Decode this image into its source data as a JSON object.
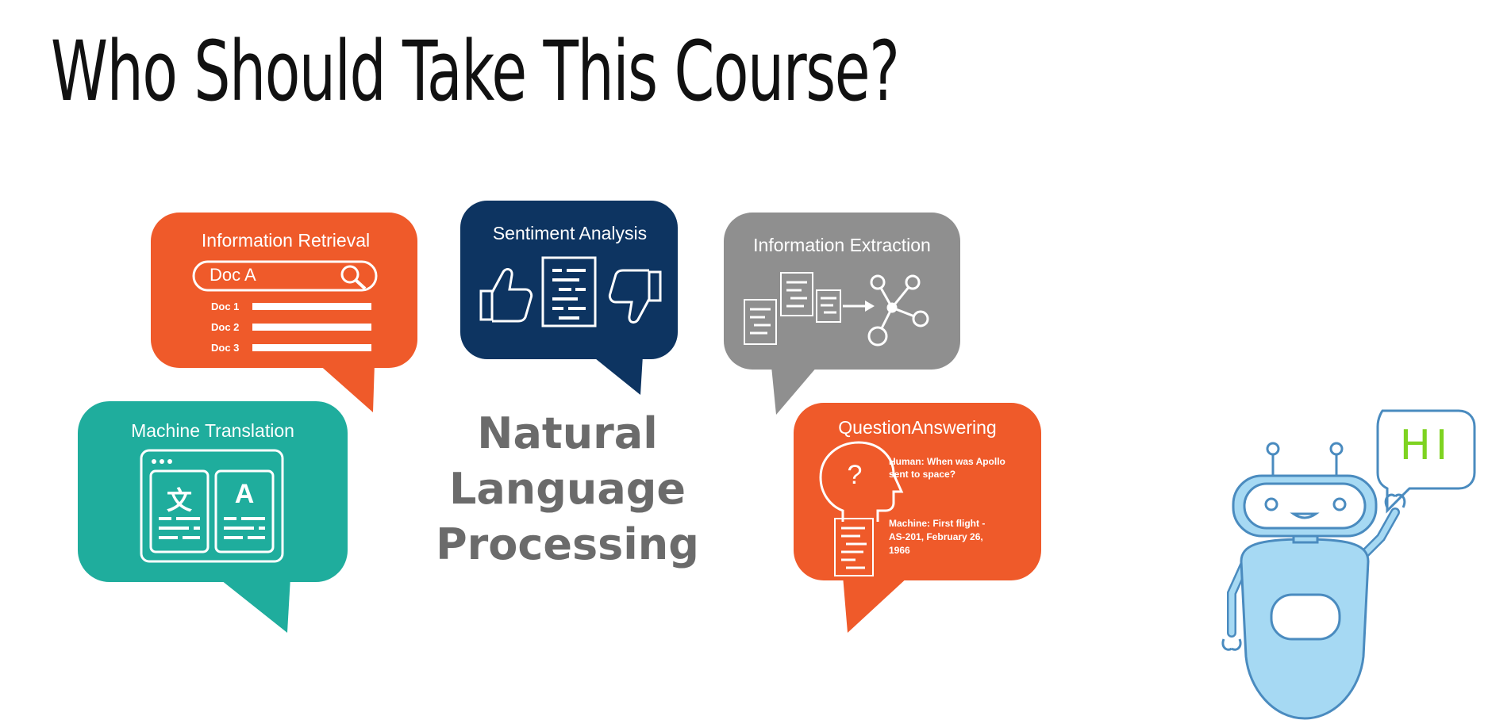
{
  "slide": {
    "title": "Who Should Take This Course?",
    "center": {
      "line1": "Natural",
      "line2": "Language",
      "line3": "Processing"
    }
  },
  "bubbles": {
    "ir": {
      "title": "Information Retrieval",
      "search": "Doc A",
      "docs": [
        "Doc 1",
        "Doc 2",
        "Doc 3"
      ],
      "color": "#ef5a2a"
    },
    "sa": {
      "title": "Sentiment Analysis",
      "color": "#0d3461"
    },
    "ie": {
      "title": "Information Extraction",
      "color": "#8f8f8f"
    },
    "mt": {
      "title": "Machine Translation",
      "src_glyph": "文",
      "dst_glyph": "A",
      "color": "#1fad9d"
    },
    "qa": {
      "title": "QuestionAnswering",
      "q_glyph": "?",
      "human": "Human: When was Apollo sent to space?",
      "machine": "Machine: First flight - AS-201, February 26, 1966",
      "color": "#ef5a2a"
    }
  },
  "robot": {
    "speech": "HI",
    "speech_color": "#7ed321",
    "body_color": "#a6d9f3",
    "outline_color": "#4a8bbf"
  }
}
